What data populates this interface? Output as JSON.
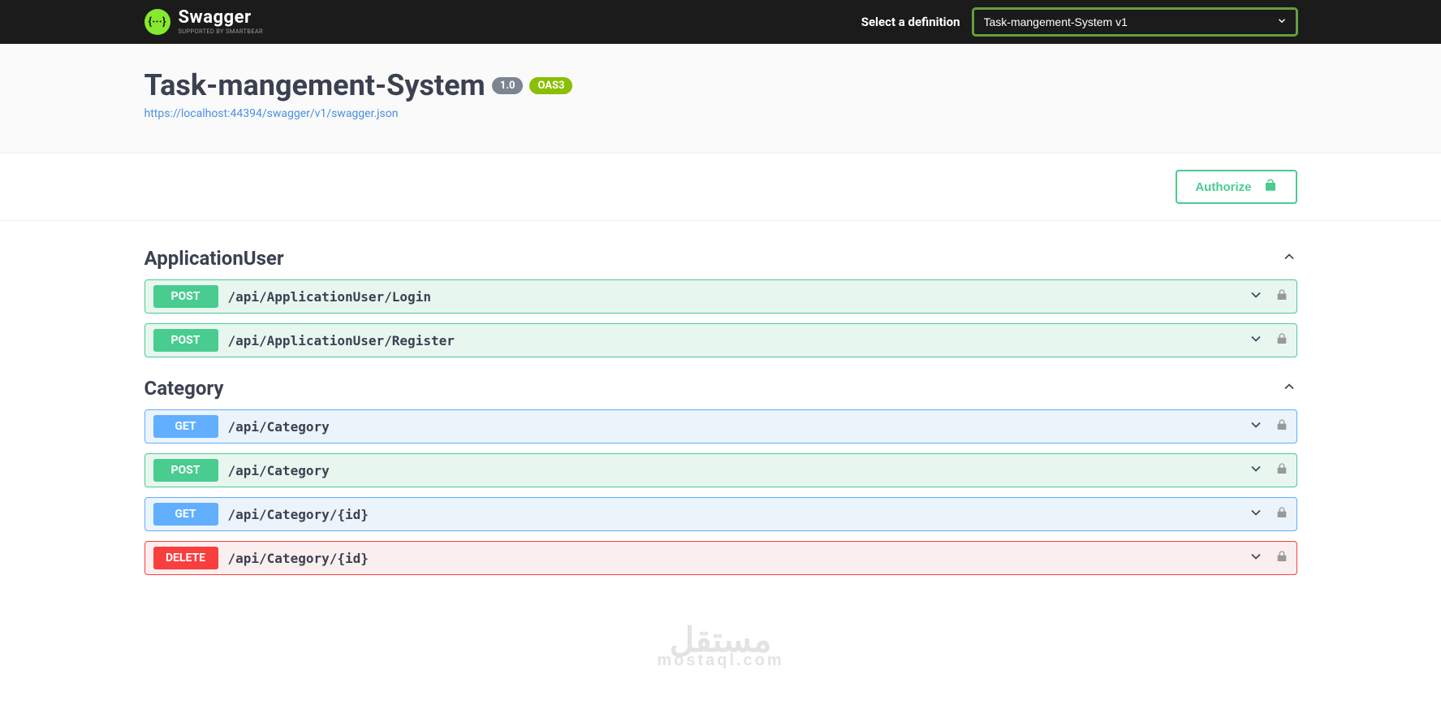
{
  "topbar": {
    "logo_main": "Swagger",
    "logo_sub": "Supported by SMARTBEAR",
    "definition_label": "Select a definition",
    "definition_selected": "Task-mangement-System v1"
  },
  "info": {
    "title": "Task-mangement-System",
    "version": "1.0",
    "oas": "OAS3",
    "url": "https://localhost:44394/swagger/v1/swagger.json"
  },
  "authorize": {
    "label": "Authorize"
  },
  "tags": [
    {
      "name": "ApplicationUser",
      "operations": [
        {
          "method": "POST",
          "path": "/api/ApplicationUser/Login"
        },
        {
          "method": "POST",
          "path": "/api/ApplicationUser/Register"
        }
      ]
    },
    {
      "name": "Category",
      "operations": [
        {
          "method": "GET",
          "path": "/api/Category"
        },
        {
          "method": "POST",
          "path": "/api/Category"
        },
        {
          "method": "GET",
          "path": "/api/Category/{id}"
        },
        {
          "method": "DELETE",
          "path": "/api/Category/{id}"
        }
      ]
    }
  ],
  "watermark": {
    "main": "مستقل",
    "sub": "mostaql.com"
  }
}
